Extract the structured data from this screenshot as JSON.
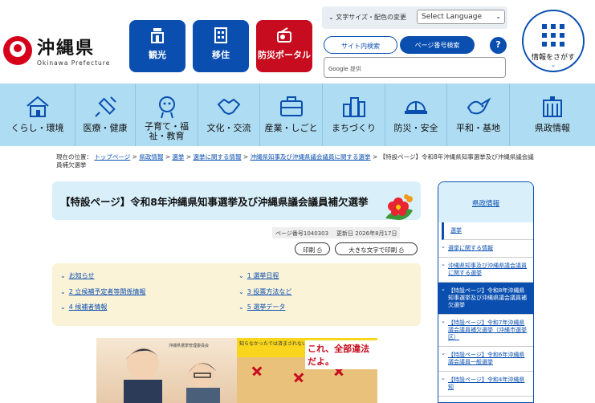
{
  "header": {
    "logo_ja": "沖縄県",
    "logo_en": "Okinawa Prefecture",
    "quick_buttons": [
      {
        "label": "観光",
        "icon": "tourism-icon"
      },
      {
        "label": "移住",
        "icon": "building-icon"
      },
      {
        "label": "防災ポータル",
        "icon": "radio-icon"
      }
    ],
    "font_size_color": "文字サイズ・配色の変更",
    "language_select": "Select Language",
    "site_search_tab": "サイト内検索",
    "page_number_tab": "ページ番号検索",
    "help": "?",
    "search_brand": "Google",
    "search_suffix": "提供",
    "menu_title": "情報をさがす",
    "menu_chevron": "⌄"
  },
  "nav": [
    {
      "label": "くらし・環境",
      "icon": "house-icon"
    },
    {
      "label": "医療・健康",
      "icon": "syringe-icon"
    },
    {
      "label": "子育て・福祉・教育",
      "icon": "child-icon"
    },
    {
      "label": "文化・交流",
      "icon": "handshake-icon"
    },
    {
      "label": "産業・しごと",
      "icon": "briefcase-icon"
    },
    {
      "label": "まちづくり",
      "icon": "city-icon"
    },
    {
      "label": "防災・安全",
      "icon": "helmet-icon"
    },
    {
      "label": "平和・基地",
      "icon": "dove-icon"
    },
    {
      "label": "県政情報",
      "icon": "government-icon"
    }
  ],
  "breadcrumb": {
    "prefix": "現在の位置：",
    "links": [
      "トップページ",
      "県政情報",
      "選挙",
      "選挙に関する情報",
      "沖縄県知事及び沖縄県議会議員に関する選挙"
    ],
    "current": "【特設ページ】令和8年沖縄県知事選挙及び沖縄県議会議員補欠選挙",
    "separator": ">"
  },
  "page": {
    "title": "【特設ページ】令和8年沖縄県知事選挙及び沖縄県議会議員補欠選挙",
    "page_number": "ページ番号1040303",
    "updated": "更新日  2026年8月17日",
    "print_label": "印刷",
    "large_print_label": "大きな文字で印刷"
  },
  "toc": [
    "お知らせ",
    "1  選挙日程",
    "2  立候補予定者等関係情報",
    "3  投票方法など",
    "4  候補者情報",
    "5  選挙データ"
  ],
  "poster": {
    "tag": "沖縄県選挙管理委員会",
    "heading": "知らなかったでは済まされない！",
    "slogan": "これ、全部違法だよ。"
  },
  "sidebar": {
    "heading": "県政情報",
    "items": [
      {
        "label": "選挙",
        "level": 1
      },
      {
        "label": "選挙に関する情報",
        "level": 2
      },
      {
        "label": "沖縄県知事及び沖縄県議会議員に関する選挙",
        "level": 3
      },
      {
        "label": "【特設ページ】令和8年沖縄県知事選挙及び沖縄県議会議員補欠選挙",
        "level": 3,
        "active": true
      },
      {
        "label": "【特設ページ】令和7年沖縄県議会議員補欠選挙（沖縄市選挙区）",
        "level": 3
      },
      {
        "label": "【特設ページ】令和6年沖縄県議会議員一般選挙",
        "level": 3
      },
      {
        "label": "【特設ページ】令和4年沖縄県知",
        "level": 3
      }
    ]
  },
  "colors": {
    "brand_blue": "#0a4fb0",
    "brand_red": "#c60c1e",
    "nav_bg": "#aedcf2"
  }
}
